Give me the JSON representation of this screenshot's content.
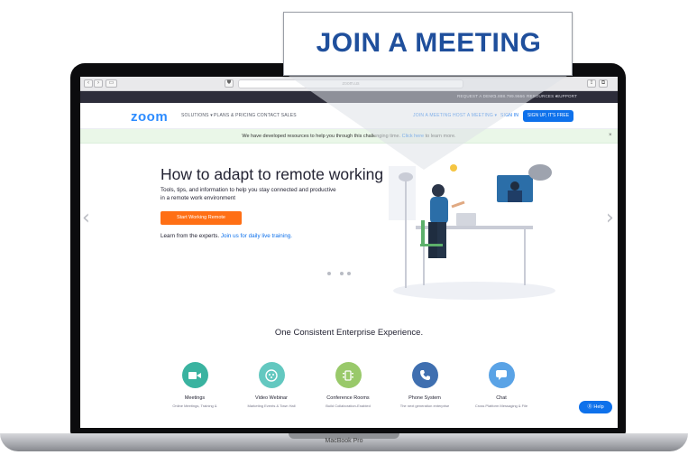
{
  "callout": {
    "label": "JOIN A MEETING"
  },
  "device": {
    "label": "MacBook Pro"
  },
  "browser": {
    "address": "zoom.us"
  },
  "utility_bar": {
    "items": [
      "REQUEST A DEMO",
      "1.888.799.9666",
      "RESOURCES ▾",
      "SUPPORT"
    ]
  },
  "nav": {
    "logo": "zoom",
    "left_items": [
      "SOLUTIONS ▾",
      "PLANS & PRICING",
      "CONTACT SALES"
    ],
    "right_items": [
      "JOIN A MEETING",
      "HOST A MEETING ▾",
      "SIGN IN"
    ],
    "signup": "SIGN UP, IT'S FREE"
  },
  "notice": {
    "text_before": "We have developed resources to help you through this challenging time. ",
    "link": "Click here",
    "text_after": " to learn more.",
    "close": "×"
  },
  "hero": {
    "title": "How to adapt to remote working",
    "subtitle": "Tools, tips, and information to help you stay connected and productive in a remote work environment",
    "cta": "Start Working Remote",
    "learn_prefix": "Learn from the experts. ",
    "learn_link": "Join us for daily live training."
  },
  "features": {
    "title": "One Consistent Enterprise Experience.",
    "items": [
      {
        "name": "Meetings",
        "desc": "Online Meetings, Training &",
        "color": "#3ab3a0"
      },
      {
        "name": "Video Webinar",
        "desc": "Marketing Events & Town Hall",
        "color": "#63c8c0"
      },
      {
        "name": "Conference Rooms",
        "desc": "Build Collaboration-Enabled",
        "color": "#99c96a"
      },
      {
        "name": "Phone System",
        "desc": "The next generation enterprise",
        "color": "#3f6fb0"
      },
      {
        "name": "Chat",
        "desc": "Cross Platform Messaging & File",
        "color": "#5aa3e6"
      }
    ]
  },
  "help": {
    "label": "⓪ Help"
  },
  "colors": {
    "brand": "#2d8cff",
    "cta": "#ff6f15",
    "link": "#0e71eb",
    "callout_text": "#1f4f9c"
  }
}
